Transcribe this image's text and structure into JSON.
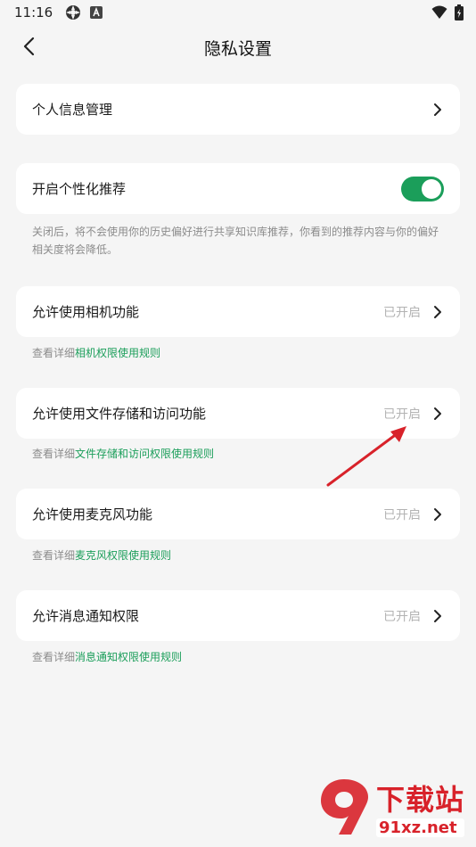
{
  "status_bar": {
    "time": "11:16"
  },
  "header": {
    "title": "隐私设置"
  },
  "items": [
    {
      "label": "个人信息管理"
    },
    {
      "label": "开启个性化推荐",
      "enabled": true,
      "description": "关闭后，将不会使用你的历史偏好进行共享知识库推荐，你看到的推荐内容与你的偏好相关度将会降低。"
    },
    {
      "label": "允许使用相机功能",
      "status": "已开启",
      "sub_prefix": "查看详细",
      "sub_link": "相机权限使用规则"
    },
    {
      "label": "允许使用文件存储和访问功能",
      "status": "已开启",
      "sub_prefix": "查看详细",
      "sub_link": "文件存储和访问权限使用规则"
    },
    {
      "label": "允许使用麦克风功能",
      "status": "已开启",
      "sub_prefix": "查看详细",
      "sub_link": "麦克风权限使用规则"
    },
    {
      "label": "允许消息通知权限",
      "status": "已开启",
      "sub_prefix": "查看详细",
      "sub_link": "消息通知权限使用规则"
    }
  ],
  "colors": {
    "accent": "#1b9e5a",
    "background": "#f5f5f5",
    "annotation": "#d8222a"
  },
  "watermark": {
    "brand": "下载站",
    "domain": "91xz.net"
  }
}
